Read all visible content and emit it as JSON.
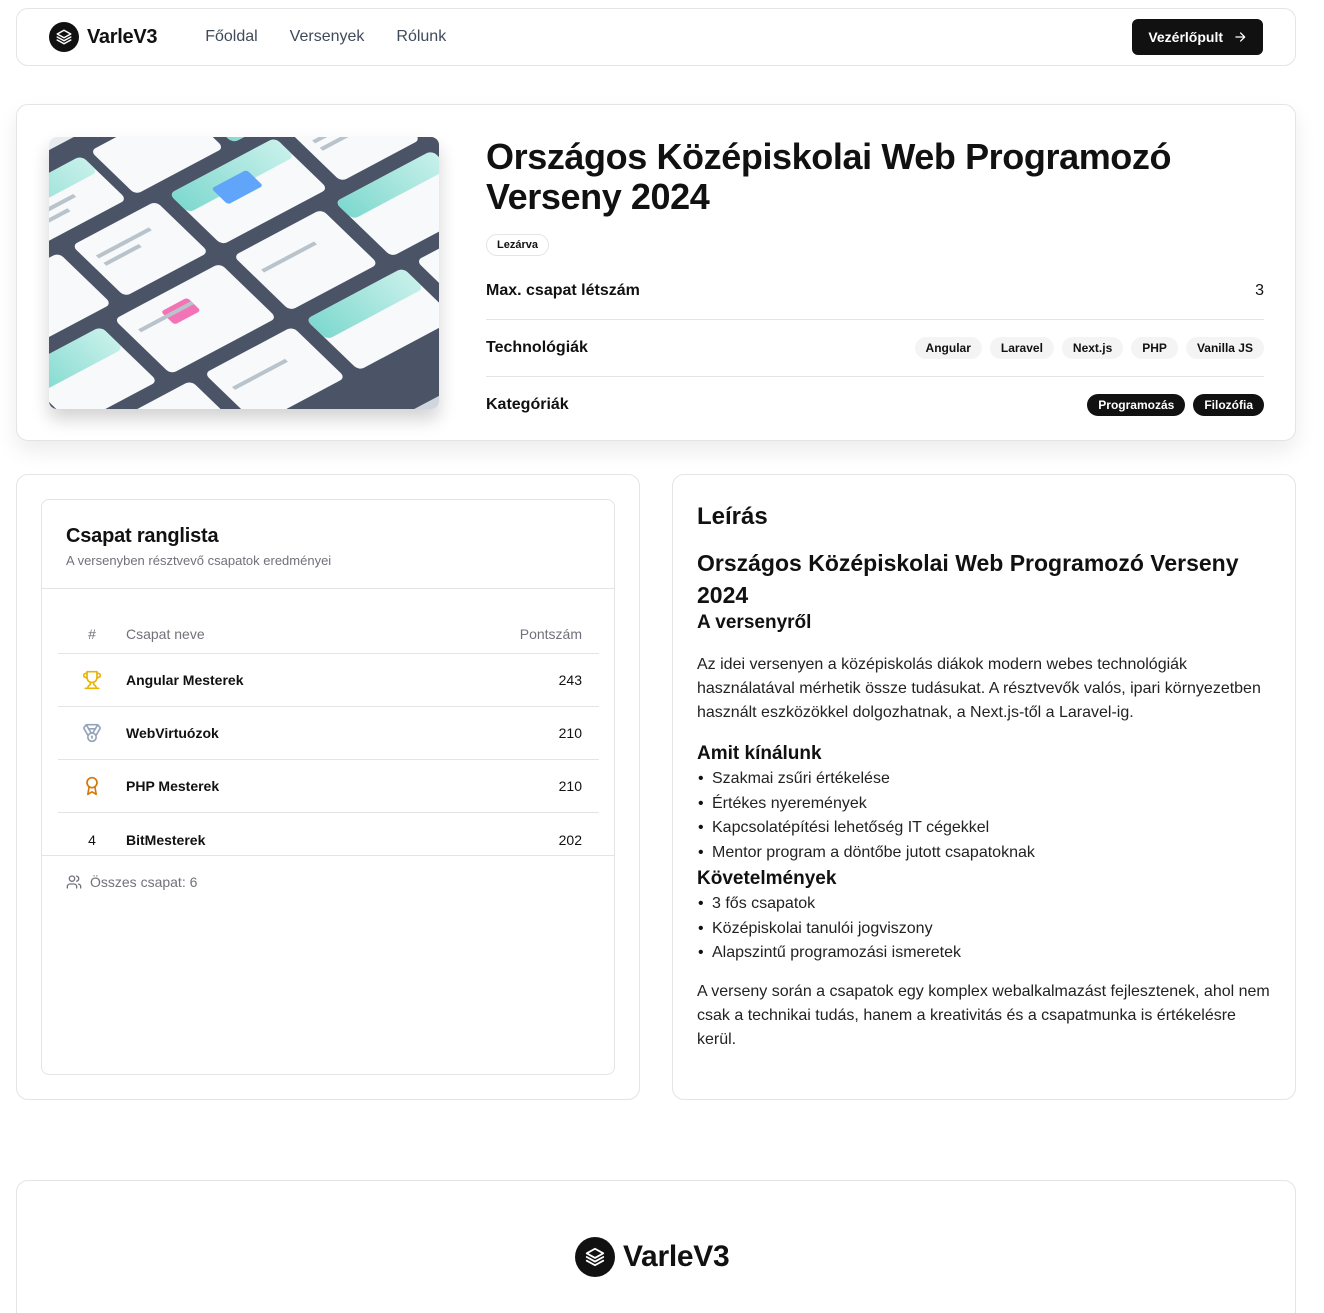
{
  "brand": {
    "name": "VarleV3",
    "icon": "layers-icon"
  },
  "nav": {
    "links": [
      "Főoldal",
      "Versenyek",
      "Rólunk"
    ],
    "cta_label": "Vezérlőpult",
    "cta_icon": "arrow-right-icon"
  },
  "hero": {
    "title": "Országos Középiskolai Web Programozó Verseny 2024",
    "status": "Lezárva",
    "max_team_label": "Max. csapat létszám",
    "max_team_value": "3",
    "tech_label": "Technológiák",
    "technologies": [
      "Angular",
      "Laravel",
      "Next.js",
      "PHP",
      "Vanilla JS"
    ],
    "cat_label": "Kategóriák",
    "categories": [
      "Programozás",
      "Filozófia"
    ]
  },
  "leaderboard": {
    "title": "Csapat ranglista",
    "subtitle": "A versenyben résztvevő csapatok eredményei",
    "columns": {
      "rank": "#",
      "name": "Csapat neve",
      "score": "Pontszám"
    },
    "rows": [
      {
        "rank_icon": "trophy-icon",
        "name": "Angular Mesterek",
        "score": "243"
      },
      {
        "rank_icon": "medal-icon",
        "name": "WebVirtuózok",
        "score": "210"
      },
      {
        "rank_icon": "award-icon",
        "name": "PHP Mesterek",
        "score": "210"
      },
      {
        "rank": "4",
        "name": "BitMesterek",
        "score": "202"
      }
    ],
    "footer": "Összes csapat: 6",
    "footer_icon": "users-icon",
    "colors": {
      "gold": "#eab308",
      "silver": "#94a3b8",
      "bronze": "#d97706"
    }
  },
  "description": {
    "heading": "Leírás",
    "title": "Országos Középiskolai Web Programozó Verseny 2024",
    "subtitle": "A versenyről",
    "p1": "Az idei versenyen a középiskolás diákok modern webes technológiák használatával mérhetik össze tudásukat. A résztvevők valós, ipari környezetben használt eszközökkel dolgozhatnak, a Next.js-től a Laravel-ig.",
    "offer_heading": "Amit kínálunk",
    "offer": [
      "Szakmai zsűri értékelése",
      "Értékes nyeremények",
      "Kapcsolatépítési lehetőség IT cégekkel",
      "Mentor program a döntőbe jutott csapatoknak"
    ],
    "req_heading": "Követelmények",
    "requirements": [
      "3 fős csapatok",
      "Középiskolai tanulói jogviszony",
      "Alapszintű programozási ismeretek"
    ],
    "p2": "A verseny során a csapatok egy komplex webalkalmazást fejlesztenek, ahol nem csak a technikai tudás, hanem a kreativitás és a csapatmunka is értékelésre kerül."
  },
  "footer": {
    "brand": "VarleV3"
  }
}
